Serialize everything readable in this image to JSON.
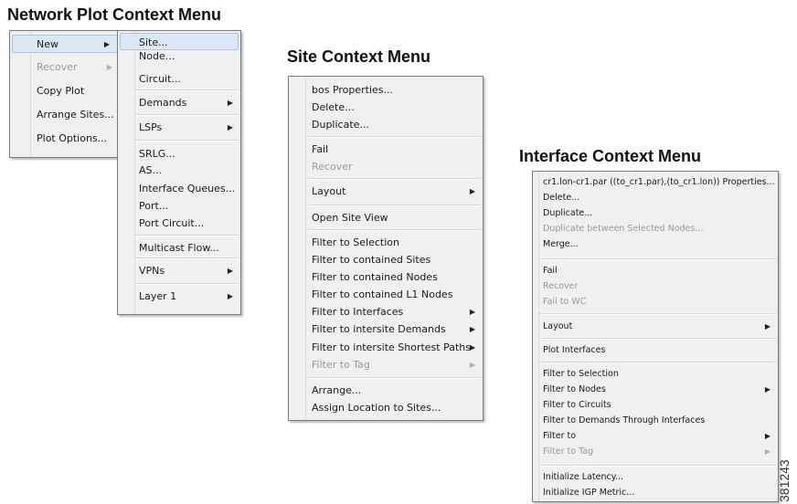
{
  "headings": {
    "network": "Network Plot Context Menu",
    "site": "Site Context Menu",
    "interface": "Interface Context Menu"
  },
  "network_menu": {
    "items": [
      {
        "label": "New",
        "submenu": true,
        "disabled": false,
        "highlighted": true
      },
      {
        "label": "Recover",
        "submenu": true,
        "disabled": true
      },
      {
        "label": "Copy Plot",
        "submenu": false,
        "disabled": false
      },
      {
        "label": "Arrange Sites...",
        "submenu": false,
        "disabled": false
      },
      {
        "label": "Plot Options...",
        "submenu": false,
        "disabled": false
      }
    ]
  },
  "new_submenu": {
    "items": [
      {
        "label": "Site...",
        "submenu": false,
        "highlighted": true
      },
      {
        "label": "Node...",
        "submenu": false
      },
      {
        "label": "Circuit...",
        "submenu": false
      },
      {
        "label": "Demands",
        "submenu": true
      },
      {
        "label": "LSPs",
        "submenu": true
      },
      {
        "label": "SRLG...",
        "submenu": false
      },
      {
        "label": "AS...",
        "submenu": false
      },
      {
        "label": "Interface Queues...",
        "submenu": false
      },
      {
        "label": "Port...",
        "submenu": false
      },
      {
        "label": "Port Circuit...",
        "submenu": false
      },
      {
        "label": "Multicast Flow...",
        "submenu": false
      },
      {
        "label": "VPNs",
        "submenu": true
      },
      {
        "label": "Layer 1",
        "submenu": true
      }
    ]
  },
  "site_menu": {
    "items": [
      {
        "label": "bos Properties...",
        "submenu": false,
        "disabled": false
      },
      {
        "label": "Delete...",
        "submenu": false,
        "disabled": false
      },
      {
        "label": "Duplicate...",
        "submenu": false,
        "disabled": false
      },
      {
        "label": "Fail",
        "submenu": false,
        "disabled": false
      },
      {
        "label": "Recover",
        "submenu": false,
        "disabled": true
      },
      {
        "label": "Layout",
        "submenu": true,
        "disabled": false
      },
      {
        "label": "Open Site View",
        "submenu": false,
        "disabled": false
      },
      {
        "label": "Filter to Selection",
        "submenu": false,
        "disabled": false
      },
      {
        "label": "Filter to contained Sites",
        "submenu": false,
        "disabled": false
      },
      {
        "label": "Filter to contained Nodes",
        "submenu": false,
        "disabled": false
      },
      {
        "label": "Filter to contained L1 Nodes",
        "submenu": false,
        "disabled": false
      },
      {
        "label": "Filter to Interfaces",
        "submenu": true,
        "disabled": false
      },
      {
        "label": "Filter to intersite Demands",
        "submenu": true,
        "disabled": false
      },
      {
        "label": "Filter to intersite Shortest Paths",
        "submenu": true,
        "disabled": false
      },
      {
        "label": "Filter to Tag",
        "submenu": true,
        "disabled": true
      },
      {
        "label": "Arrange...",
        "submenu": false,
        "disabled": false
      },
      {
        "label": "Assign Location to Sites...",
        "submenu": false,
        "disabled": false
      }
    ]
  },
  "interface_menu": {
    "items": [
      {
        "label": "cr1.lon-cr1.par ((to_cr1.par),(to_cr1.lon)) Properties...",
        "submenu": false,
        "disabled": false
      },
      {
        "label": "Delete...",
        "submenu": false,
        "disabled": false
      },
      {
        "label": "Duplicate...",
        "submenu": false,
        "disabled": false
      },
      {
        "label": "Duplicate between Selected Nodes...",
        "submenu": false,
        "disabled": true
      },
      {
        "label": "Merge...",
        "submenu": false,
        "disabled": false
      },
      {
        "label": "Fail",
        "submenu": false,
        "disabled": false
      },
      {
        "label": "Recover",
        "submenu": false,
        "disabled": true
      },
      {
        "label": "Fail to WC",
        "submenu": false,
        "disabled": true
      },
      {
        "label": "Layout",
        "submenu": true,
        "disabled": false
      },
      {
        "label": "Plot Interfaces",
        "submenu": false,
        "disabled": false
      },
      {
        "label": "Filter to Selection",
        "submenu": false,
        "disabled": false
      },
      {
        "label": "Filter to Nodes",
        "submenu": true,
        "disabled": false
      },
      {
        "label": "Filter to Circuits",
        "submenu": false,
        "disabled": false
      },
      {
        "label": "Filter to Demands Through Interfaces",
        "submenu": false,
        "disabled": false
      },
      {
        "label": "Filter to",
        "submenu": true,
        "disabled": false
      },
      {
        "label": "Filter to Tag",
        "submenu": true,
        "disabled": true
      },
      {
        "label": "Initialize Latency...",
        "submenu": false,
        "disabled": false
      },
      {
        "label": "Initialize IGP Metric...",
        "submenu": false,
        "disabled": false
      }
    ]
  },
  "figure_id": "381243",
  "colors": {
    "menu_bg": "#f0f0f0",
    "highlight_bg": "#dde8f6",
    "highlight_border": "#a8c4e8",
    "disabled_text": "#9a9a9a"
  },
  "icons": {
    "submenu_arrow": "submenu-arrow-icon"
  }
}
